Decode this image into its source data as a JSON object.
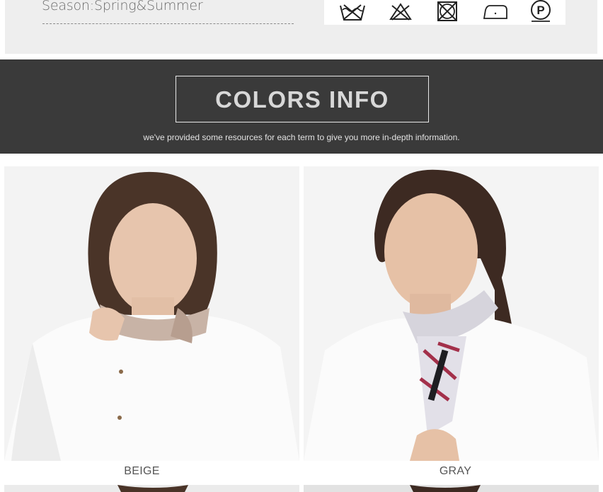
{
  "details": {
    "season_text": "Season:Spring&Summer"
  },
  "care_icons": [
    "hand-wash-icon",
    "do-not-bleach-icon",
    "do-not-tumble-dry-icon",
    "iron-low-icon",
    "dry-clean-p-icon"
  ],
  "care_dry_clean_letter": "P",
  "banner": {
    "title": "COLORS INFO",
    "subtitle": "we've provided some resources for each term to give you more in-depth information."
  },
  "colors": [
    {
      "name": "BEIGE",
      "swatch": "#c8b3a6"
    },
    {
      "name": "GRAY",
      "swatch": "#d6d4dc"
    }
  ],
  "palette": {
    "banner_bg": "#3a3a3a",
    "panel_bg": "#eeeeee"
  }
}
